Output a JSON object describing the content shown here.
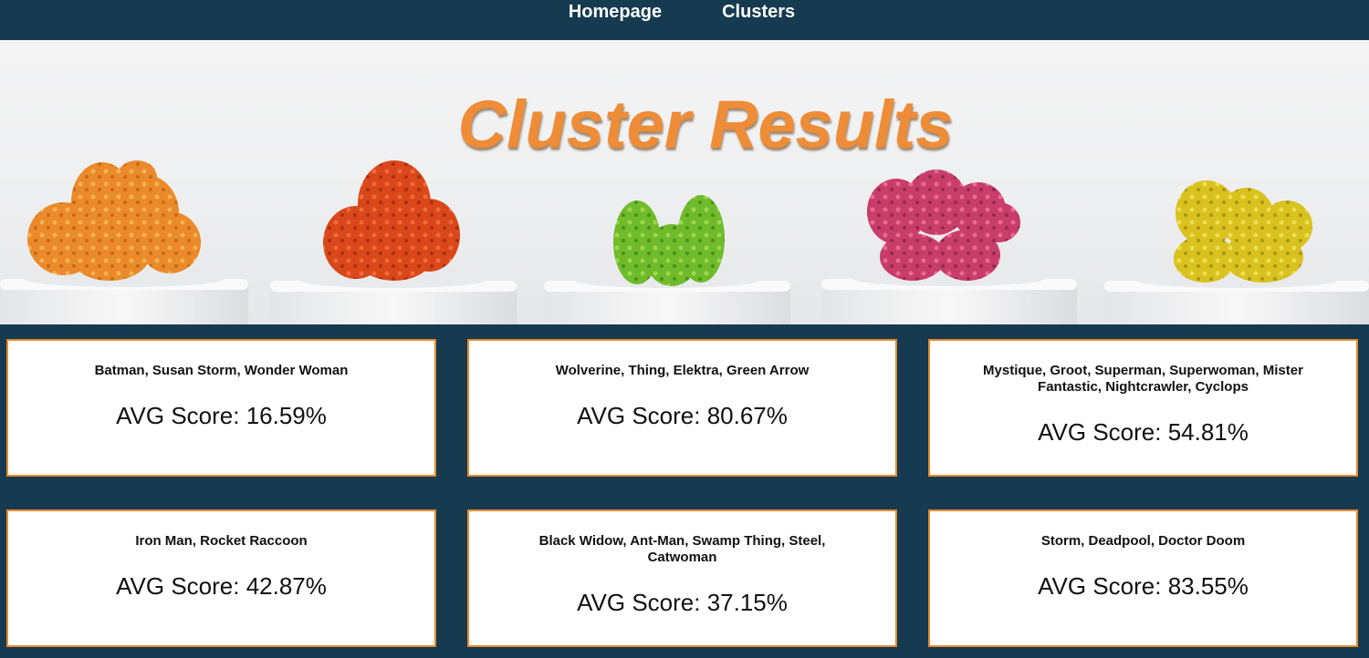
{
  "nav": {
    "items": [
      {
        "label": "Homepage"
      },
      {
        "label": "Clusters"
      }
    ]
  },
  "hero": {
    "title": "Cluster Results"
  },
  "colors": {
    "background": "#163a4f",
    "accent": "#e8892f",
    "title": "#ee8c37"
  },
  "clusters": [
    {
      "names": "Batman, Susan Storm, Wonder Woman",
      "score": "AVG Score: 16.59%"
    },
    {
      "names": "Wolverine, Thing, Elektra, Green Arrow",
      "score": "AVG Score: 80.67%"
    },
    {
      "names": "Mystique, Groot, Superman, Superwoman, Mister Fantastic, Nightcrawler, Cyclops",
      "score": "AVG Score: 54.81%"
    },
    {
      "names": "Iron Man, Rocket Raccoon",
      "score": "AVG Score: 42.87%"
    },
    {
      "names": "Black Widow, Ant-Man, Swamp Thing, Steel, Catwoman",
      "score": "AVG Score: 37.15%"
    },
    {
      "names": "Storm, Deadpool, Doctor Doom",
      "score": "AVG Score: 83.55%"
    }
  ]
}
